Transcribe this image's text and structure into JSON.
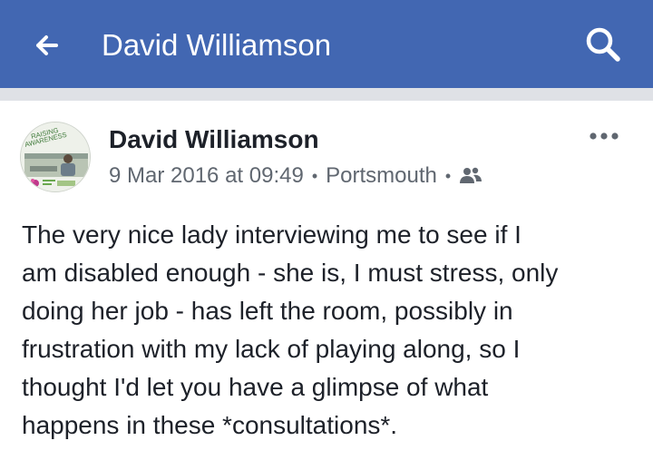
{
  "header": {
    "title": "David Williamson",
    "back_icon": "arrow-left-icon",
    "search_icon": "search-icon",
    "color": "#4267b2"
  },
  "post": {
    "author": "David Williamson",
    "date": "9 Mar 2016 at 09:49",
    "location": "Portsmouth",
    "separator": "•",
    "audience_icon": "friends-icon",
    "avatar_badge_line1": "RAISING",
    "avatar_badge_line2": "AWARENESS",
    "more_icon": "more-options-icon",
    "text_lines": [
      "The very nice lady interviewing me to see if I",
      "am disabled enough - she is, I must stress, only",
      "doing her job - has left the room, possibly in",
      "frustration with my lack of playing along, so I",
      "thought I'd let you have a glimpse of what",
      "happens in these *consultations*."
    ]
  }
}
